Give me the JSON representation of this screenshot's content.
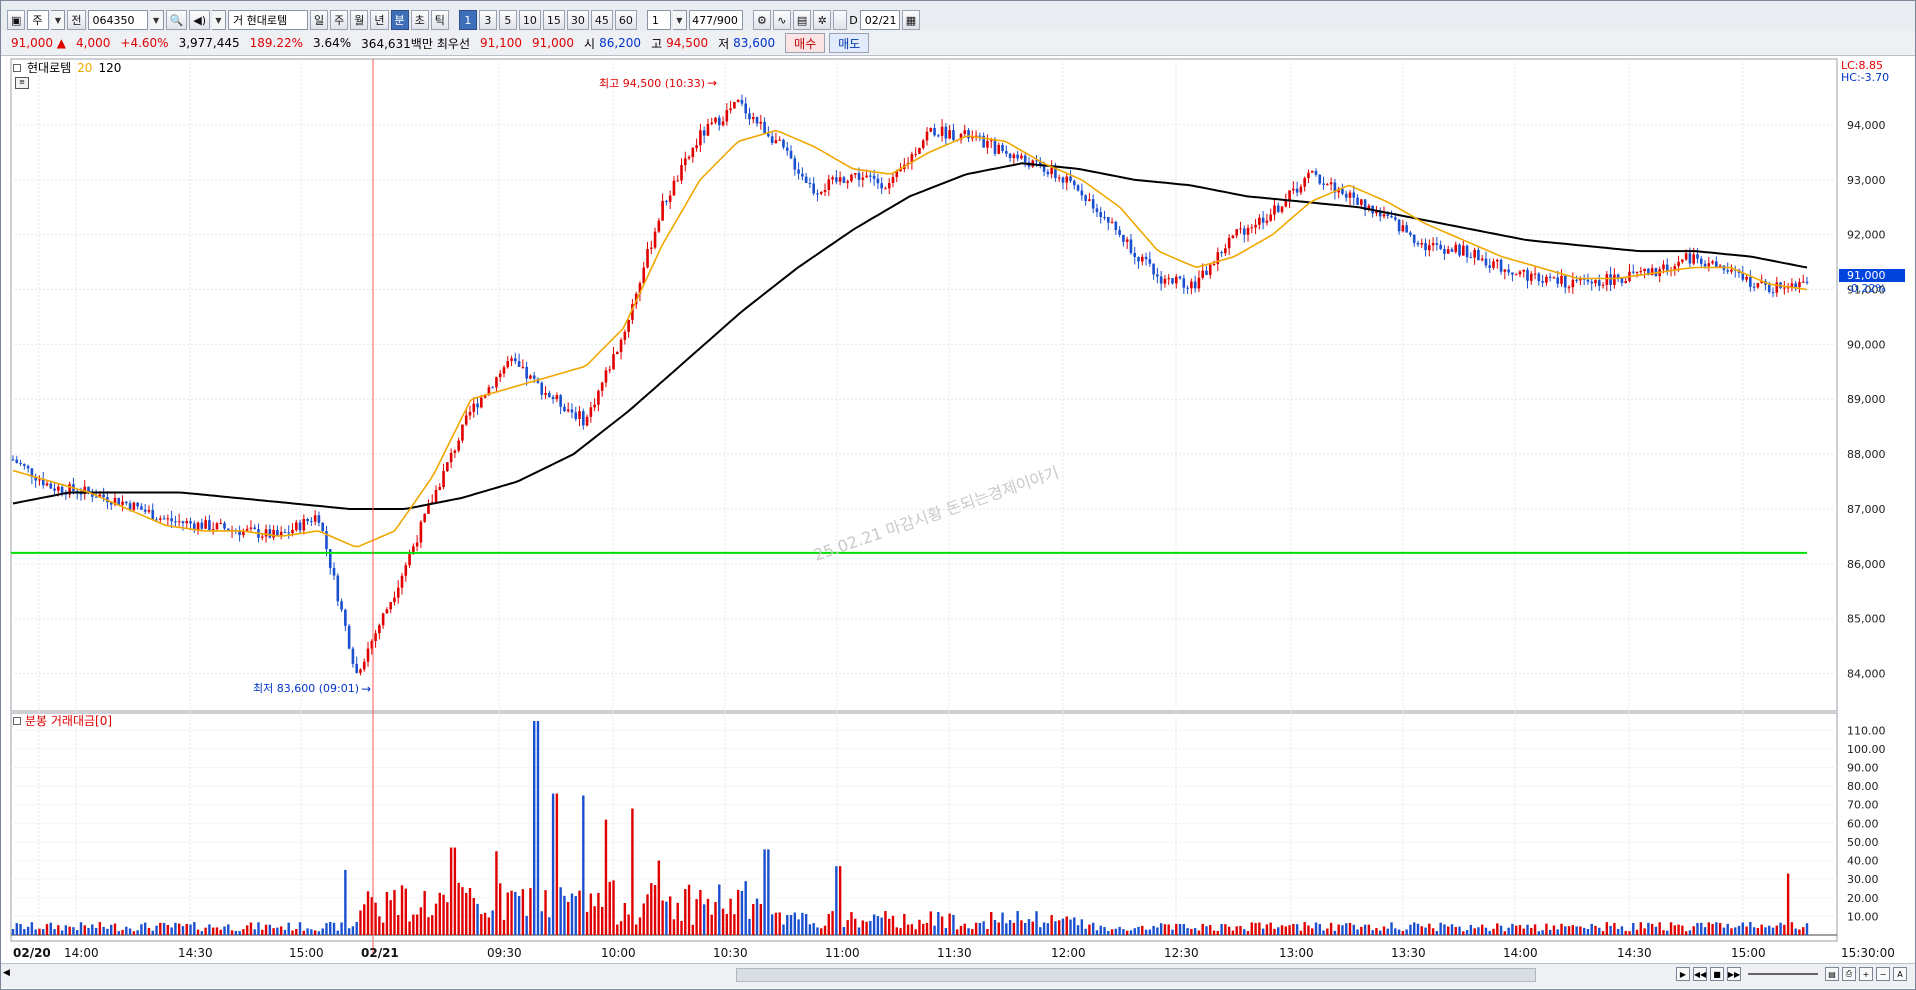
{
  "toolbar": {
    "mode_code": "주",
    "jeon_label": "전",
    "stock_code": "064350",
    "search_icon": "search-icon",
    "speaker_icon": "speaker-icon",
    "stock_name": "거 현대로템",
    "periods": [
      "일",
      "주",
      "월",
      "년",
      "분",
      "초",
      "틱"
    ],
    "selected_period": "분",
    "intervals": [
      "1",
      "3",
      "5",
      "10",
      "15",
      "30",
      "45",
      "60"
    ],
    "selected_interval": "1",
    "count_value": "1",
    "bars_value": "477/900",
    "date_checkbox_label": "D",
    "date_value": "02/21"
  },
  "quote": {
    "price": "91,000 ▲",
    "change": "4,000",
    "change_pct": "+4.60%",
    "volume": "3,977,445",
    "volume_ratio": "189.22%",
    "turnover_rate": "3.64%",
    "amount": "364,631백만",
    "best_label": "최우선",
    "best_ask": "91,100",
    "best_bid": "91,000",
    "open_label": "시",
    "open": "86,200",
    "high_label": "고",
    "high": "94,500",
    "low_label": "저",
    "low": "83,600",
    "buy_button": "매수",
    "sell_button": "매도"
  },
  "price_panel": {
    "stock_label": "현대로템",
    "ma_short": "20",
    "ma_long": "120",
    "lc_label": "LC:8.85",
    "hc_label": "HC:-3.70",
    "high_annotation": "최고 94,500 (10:33)",
    "low_annotation": "최저 83,600 (09:01)",
    "current_price_tag": "91,000",
    "current_pct_tag": "-0.22%",
    "watermark": "25.02.21 마감시황 돈되는경제이야기",
    "price_ticks": [
      "94,000",
      "93,000",
      "92,000",
      "91,000",
      "90,000",
      "89,000",
      "88,000",
      "87,000",
      "86,000",
      "85,000",
      "84,000"
    ],
    "support_line_color": "#00e000",
    "ma_short_color": "#f0a800",
    "ma_long_color": "#000000",
    "up_color": "#e00000",
    "down_color": "#1a4fd0"
  },
  "volume_panel": {
    "label": "분봉 거래대금[0]",
    "ticks": [
      "110.00",
      "100.00",
      "90.00",
      "80.00",
      "70.00",
      "60.00",
      "50.00",
      "40.00",
      "30.00",
      "20.00",
      "10.00"
    ]
  },
  "time_axis": {
    "labels": [
      "02/20",
      "14:00",
      "14:30",
      "15:00",
      "02/21",
      "09:30",
      "10:00",
      "10:30",
      "11:00",
      "11:30",
      "12:00",
      "12:30",
      "13:00",
      "13:30",
      "14:00",
      "14:30",
      "15:00",
      "15:30:00"
    ]
  },
  "chart_data": {
    "type": "candlestick",
    "x_labels": [
      "02/20",
      "14:00",
      "14:30",
      "15:00",
      "02/21",
      "09:30",
      "10:00",
      "10:30",
      "11:00",
      "11:30",
      "12:00",
      "12:30",
      "13:00",
      "13:30",
      "14:00",
      "14:30",
      "15:00"
    ],
    "close_path": [
      87900,
      87400,
      87300,
      87100,
      86800,
      86700,
      86600,
      86500,
      86900,
      84000,
      85500,
      87200,
      88800,
      89700,
      89100,
      88600,
      90200,
      92500,
      93800,
      94400,
      93700,
      92800,
      93100,
      92900,
      93900,
      93800,
      93500,
      93200,
      92800,
      92000,
      91200,
      91100,
      92000,
      92400,
      93100,
      92700,
      92300,
      91800,
      91700,
      91400,
      91200,
      91100,
      91200,
      91300,
      91600,
      91300,
      91000,
      91200
    ],
    "ma20_path": [
      87700,
      87500,
      87300,
      87000,
      86700,
      86600,
      86600,
      86500,
      86600,
      86300,
      86600,
      87600,
      89000,
      89200,
      89400,
      89600,
      90300,
      91800,
      93000,
      93700,
      93900,
      93600,
      93200,
      93100,
      93500,
      93800,
      93700,
      93300,
      93000,
      92500,
      91700,
      91400,
      91600,
      92000,
      92600,
      92900,
      92600,
      92200,
      91900,
      91600,
      91400,
      91200,
      91200,
      91300,
      91400,
      91400,
      91100,
      91000
    ],
    "ma120_path": [
      87100,
      87300,
      87300,
      87300,
      87200,
      87100,
      87000,
      87000,
      87200,
      87500,
      88000,
      88800,
      89700,
      90600,
      91400,
      92100,
      92700,
      93100,
      93300,
      93200,
      93000,
      92900,
      92700,
      92600,
      92500,
      92300,
      92100,
      91900,
      91800,
      91700,
      91700,
      91600,
      91400
    ],
    "support_level": 86200,
    "high": {
      "value": 94500,
      "time": "10:33"
    },
    "low": {
      "value": 83600,
      "time": "09:01"
    },
    "last": 91000,
    "volume_peaks": [
      {
        "time": "09:45",
        "value": 115
      },
      {
        "time": "09:50",
        "value": 76
      },
      {
        "time": "10:05",
        "value": 75
      },
      {
        "time": "10:20",
        "value": 65
      },
      {
        "time": "15:30",
        "value": 33
      }
    ],
    "y_range": [
      83500,
      94800
    ],
    "volume_range": [
      0,
      115
    ]
  }
}
